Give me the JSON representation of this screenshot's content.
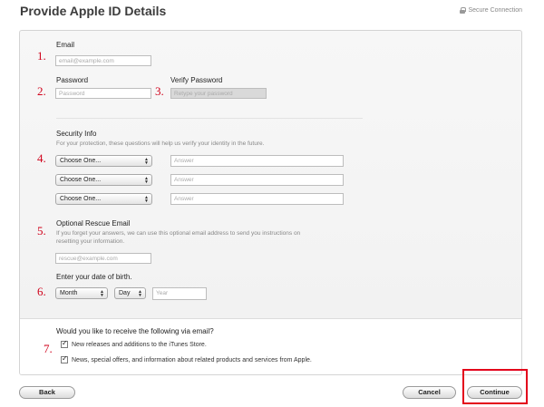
{
  "header": {
    "title": "Provide Apple ID Details",
    "secure_text": "Secure Connection"
  },
  "email": {
    "label": "Email",
    "placeholder": "email@example.com"
  },
  "password": {
    "label": "Password",
    "placeholder": "Password",
    "verify_label": "Verify Password",
    "verify_placeholder": "Retype your password"
  },
  "security": {
    "label": "Security Info",
    "description": "For your protection, these questions will help us verify your identity in the future.",
    "questions": [
      {
        "select": "Choose One...",
        "answer_placeholder": "Answer"
      },
      {
        "select": "Choose One...",
        "answer_placeholder": "Answer"
      },
      {
        "select": "Choose One...",
        "answer_placeholder": "Answer"
      }
    ]
  },
  "rescue": {
    "label": "Optional Rescue Email",
    "description_line1": "If you forget your answers, we can use this optional email address to send you instructions on",
    "description_line2": "resetting your information.",
    "placeholder": "rescue@example.com"
  },
  "birth": {
    "label": "Enter your date of birth.",
    "month": "Month",
    "day": "Day",
    "year_placeholder": "Year"
  },
  "email_prefs": {
    "question": "Would you like to receive the following via email?",
    "option1": "New releases and additions to the iTunes Store.",
    "option2": "News, special offers, and information about related products and services from Apple."
  },
  "annotations": {
    "n1": "1.",
    "n2": "2.",
    "n3": "3.",
    "n4": "4.",
    "n5": "5.",
    "n6": "6.",
    "n7": "7."
  },
  "buttons": {
    "back": "Back",
    "cancel": "Cancel",
    "continue": "Continue"
  },
  "colors": {
    "annotation_red": "#d0021b",
    "highlight_red": "#e3001b"
  }
}
